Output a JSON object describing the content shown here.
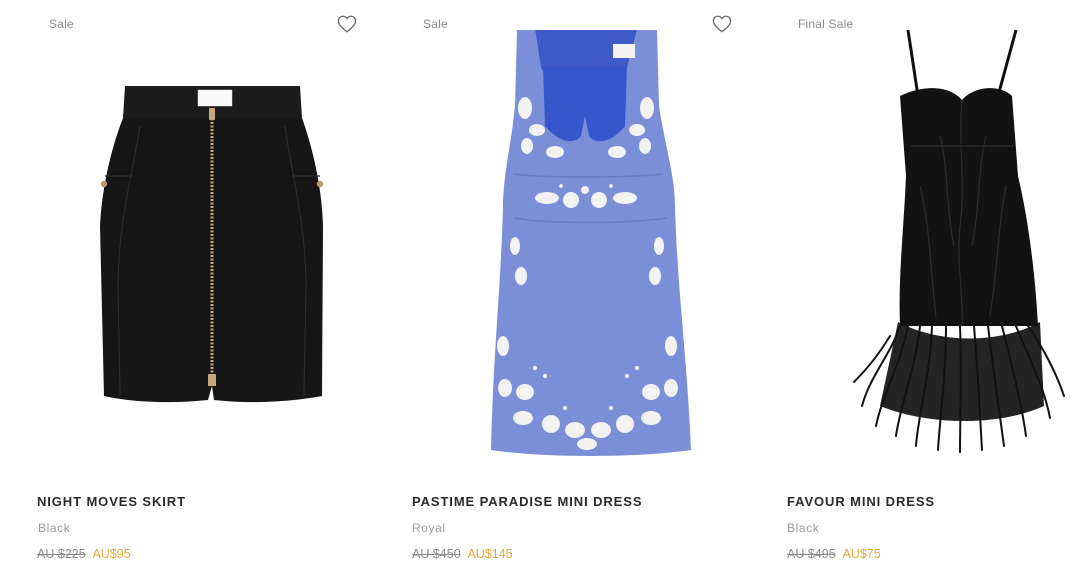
{
  "products": [
    {
      "badge": "Sale",
      "name": "NIGHT MOVES SKIRT",
      "color": "Black",
      "original_price": "AU $225",
      "sale_price": "AU$95",
      "wishlist_icon": "heart-outline-icon"
    },
    {
      "badge": "Sale",
      "name": "PASTIME PARADISE MINI DRESS",
      "color": "Royal",
      "original_price": "AU $450",
      "sale_price": "AU$145",
      "wishlist_icon": "heart-outline-icon"
    },
    {
      "badge": "Final Sale",
      "name": "FAVOUR MINI DRESS",
      "color": "Black",
      "original_price": "AU $495",
      "sale_price": "AU$75"
    }
  ],
  "colors": {
    "sale_price": "#e4a93b",
    "muted_text": "#8a8a8a",
    "skirt": "#151515",
    "dress_blue": "#7b8fd8",
    "embroidery": "#f2f2f2"
  }
}
